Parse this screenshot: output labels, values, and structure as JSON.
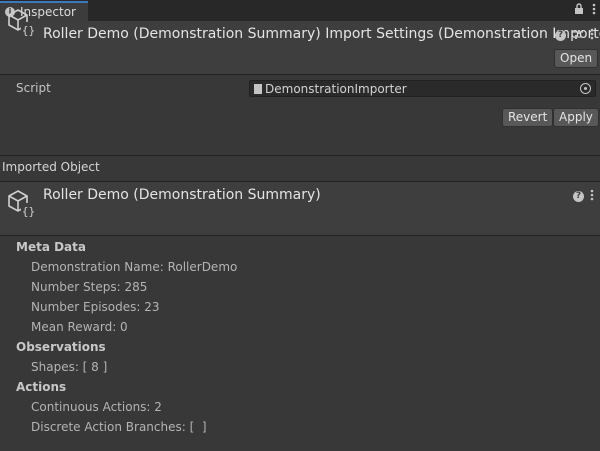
{
  "window": {
    "tab_label": "Inspector",
    "lock_icon": "lock-icon",
    "menu_icon": "kebab-menu-icon"
  },
  "importer": {
    "title": "Roller Demo (Demonstration Summary) Import Settings (Demonstration Importer)",
    "open_label": "Open",
    "script_label": "Script",
    "script_value": "DemonstrationImporter",
    "revert_label": "Revert",
    "apply_label": "Apply"
  },
  "imported_object": {
    "section_label": "Imported Object",
    "title": "Roller Demo (Demonstration Summary)"
  },
  "details": {
    "meta_data": {
      "heading": "Meta Data",
      "demonstration_name": "Demonstration Name: RollerDemo",
      "number_steps": "Number Steps: 285",
      "number_episodes": "Number Episodes: 23",
      "mean_reward": "Mean Reward: 0"
    },
    "observations": {
      "heading": "Observations",
      "shapes": "Shapes: [ 8 ]"
    },
    "actions": {
      "heading": "Actions",
      "continuous": "Continuous Actions: 2",
      "discrete": "Discrete Action Branches: [  ]"
    }
  },
  "colors": {
    "background": "#383838",
    "header": "#3e3e3e",
    "tab_accent": "#3a79bb"
  }
}
